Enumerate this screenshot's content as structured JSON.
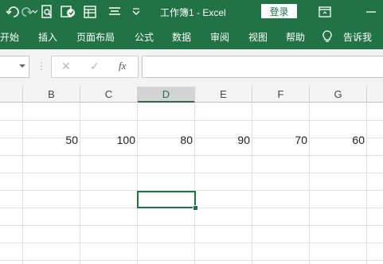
{
  "window": {
    "title": "工作簿1  -  Excel",
    "login_label": "登录"
  },
  "qat_icons": [
    "undo-icon",
    "redo-icon",
    "print-preview-icon",
    "touch-mode-icon",
    "form-icon",
    "align-icon",
    "more-icon"
  ],
  "ribbon": {
    "tabs": [
      "开始",
      "插入",
      "页面布局",
      "公式",
      "数据",
      "审阅",
      "视图",
      "帮助",
      "告诉我"
    ],
    "tell_me_icon": "lightbulb-icon"
  },
  "formula_bar": {
    "cancel_symbol": "✕",
    "enter_symbol": "✓",
    "fx_label": "fx",
    "value": ""
  },
  "sheet": {
    "columns": [
      "B",
      "C",
      "D",
      "E",
      "F",
      "G"
    ],
    "selected_column": "D",
    "row_values": [
      "50",
      "100",
      "80",
      "90",
      "70",
      "60"
    ],
    "selected_cell": "D"
  },
  "colors": {
    "accent": "#217346",
    "header_bg": "#f3f3f3",
    "gridline": "#e1e1e1"
  }
}
